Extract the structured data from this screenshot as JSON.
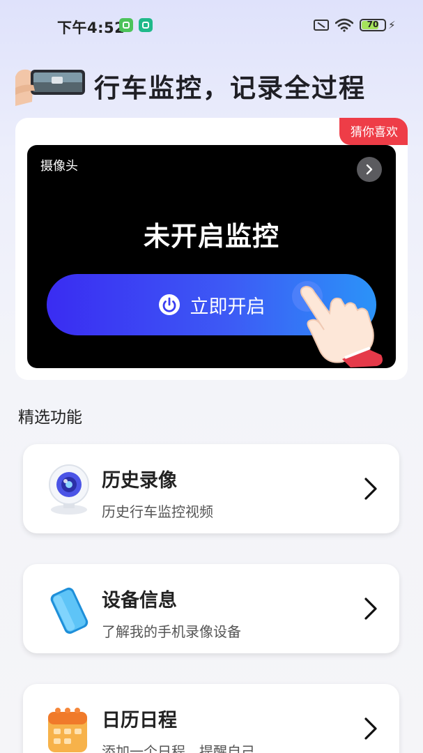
{
  "status_bar": {
    "time": "下午4:52",
    "battery_level": "70",
    "icons": [
      "app-notification-icon",
      "security-shield-icon",
      "sim-off-icon",
      "wifi-icon",
      "battery-icon",
      "charging-icon"
    ]
  },
  "header": {
    "title": "行车监控，记录全过程",
    "illustration": "hand-holding-phone-dashcam"
  },
  "camera_card": {
    "badge": "猜你喜欢",
    "camera_label": "摄像头",
    "status_text": "未开启监控",
    "start_button_label": "立即开启",
    "button_icon": "power-icon",
    "hand_illustration": "pointing-hand"
  },
  "features": {
    "section_title": "精选功能",
    "items": [
      {
        "title": "历史录像",
        "description": "历史行车监控视频",
        "icon": "webcam-icon"
      },
      {
        "title": "设备信息",
        "description": "了解我的手机录像设备",
        "icon": "phone-device-icon"
      },
      {
        "title": "日历日程",
        "description": "添加一个日程，提醒自己",
        "icon": "calendar-icon"
      }
    ]
  },
  "colors": {
    "accent_gradient_start": "#3a2cf2",
    "accent_gradient_end": "#2b93f8",
    "badge_red": "#ee3d47",
    "preview_background": "#000000"
  }
}
